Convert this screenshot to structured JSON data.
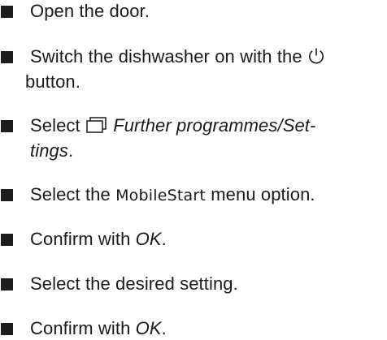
{
  "steps": [
    {
      "text": "Open the door."
    },
    {
      "before": "Switch the dishwasher on with the ",
      "icon": "power-icon",
      "after": " button."
    },
    {
      "before": "Select ",
      "icon": "programmes-icon",
      "emphasis": "Further programmes/Set-tings",
      "after": "."
    },
    {
      "before": "Select the ",
      "ui_name": "MobileStart",
      "after": " menu option."
    },
    {
      "before": "Confirm with ",
      "emphasis": "OK",
      "after": "."
    },
    {
      "text": "Select the desired setting."
    },
    {
      "before": "Confirm with ",
      "emphasis": "OK",
      "after": "."
    }
  ]
}
